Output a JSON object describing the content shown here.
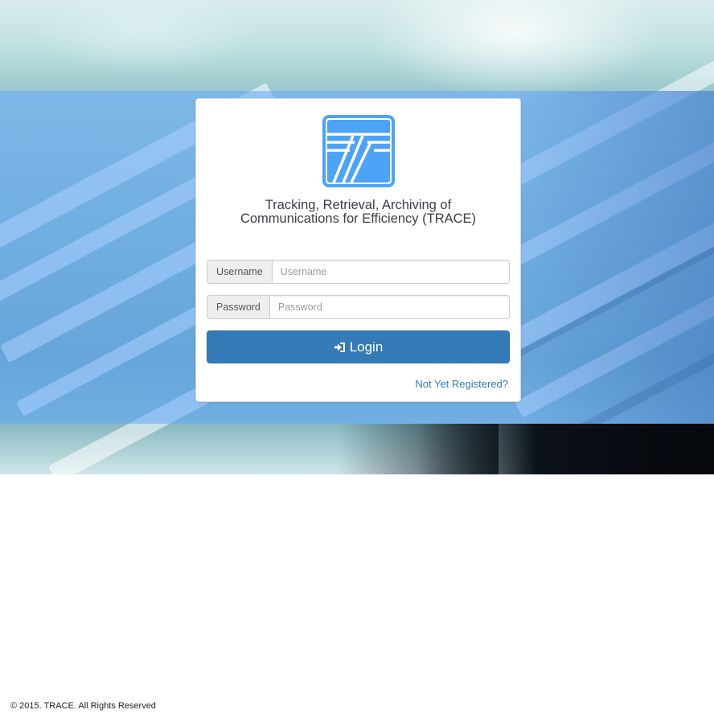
{
  "app": {
    "title_line1": "Tracking, Retrieval, Archiving of",
    "title_line2": "Communications for Efficiency (TRACE)",
    "logo_icon": "trace-logo-icon",
    "accent_color": "#337ab7",
    "logo_color": "#4da3f5"
  },
  "form": {
    "username_label": "Username",
    "username_placeholder": "Username",
    "username_value": "",
    "password_label": "Password",
    "password_placeholder": "Password",
    "password_value": "",
    "login_icon": "sign-in-icon",
    "login_label": "Login",
    "register_link": "Not Yet Registered?"
  },
  "footer": {
    "copyright": "© 2015. TRACE. All Rights Reserved"
  }
}
